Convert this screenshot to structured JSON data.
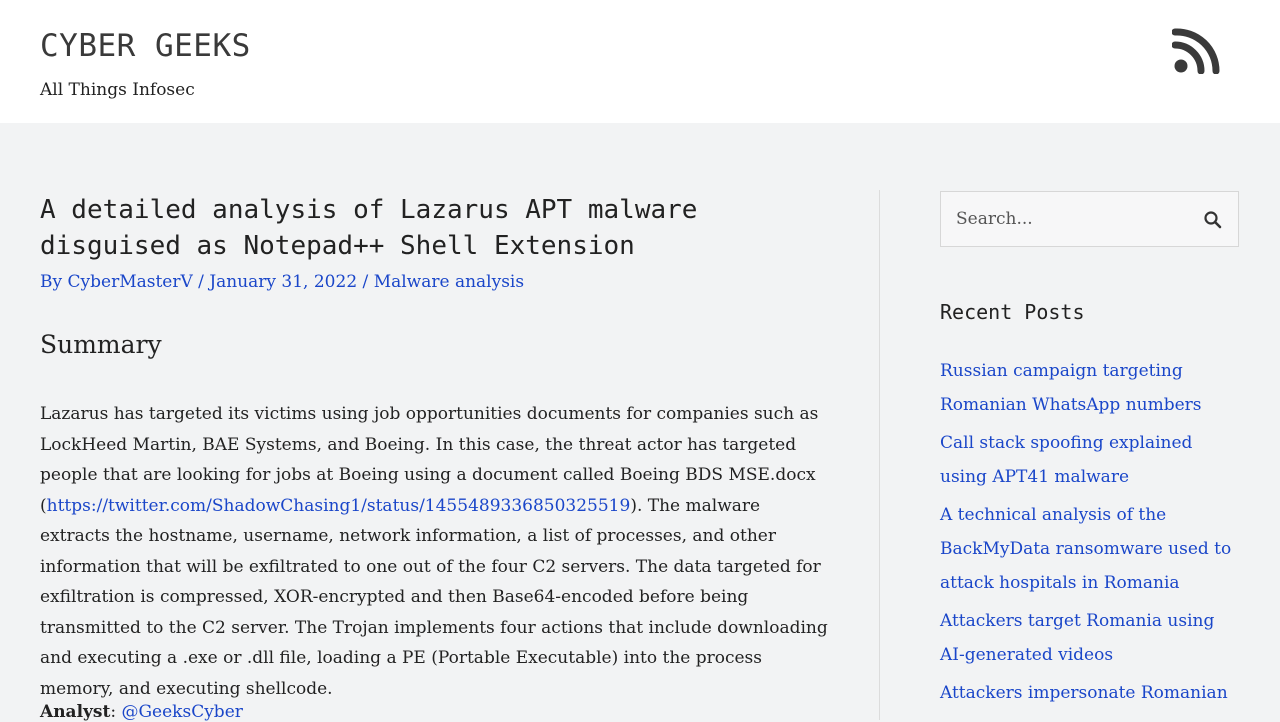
{
  "header": {
    "site_title": "CYBER GEEKS",
    "tagline": "All Things Infosec",
    "rss_icon": "rss-icon"
  },
  "post": {
    "title": "A detailed analysis of Lazarus APT malware disguised as Notepad++ Shell Extension",
    "meta": {
      "by_prefix": "By",
      "author": "CyberMasterV",
      "sep1": "/",
      "date": "January 31, 2022",
      "sep2": "/",
      "category": "Malware analysis"
    },
    "summary_heading": "Summary",
    "body_before_link": "Lazarus has targeted its victims using job opportunities documents for companies such as LockHeed Martin, BAE Systems, and Boeing. In this case, the threat actor has targeted people that are looking for jobs at Boeing using a document called Boeing BDS MSE.docx (",
    "body_link": "https://twitter.com/ShadowChasing1/status/1455489336850325519",
    "body_after_link": "). The malware extracts the hostname, username, network information, a list of processes, and other information that will be exfiltrated to one out of the four C2 servers. The data targeted for exfiltration is compressed, XOR-encrypted and then Base64-encoded before being transmitted to the C2 server. The Trojan implements four actions that include downloading and executing a .exe or .dll file, loading a PE (Portable Executable) into the process memory, and executing shellcode.",
    "analyst_label": "Analyst",
    "analyst_colon": ":",
    "analyst_handle": "@GeeksCyber"
  },
  "sidebar": {
    "search_placeholder": "Search...",
    "search_icon": "search-icon",
    "recent_heading": "Recent Posts",
    "recent_posts": [
      "Russian campaign targeting Romanian WhatsApp numbers",
      "Call stack spoofing explained using APT41 malware",
      "A technical analysis of the BackMyData ransomware used to attack hospitals in Romania",
      "Attackers target Romania using AI-generated videos",
      "Attackers impersonate Romanian"
    ]
  },
  "colors": {
    "link": "#1a46c9",
    "background": "#f2f3f4",
    "header_bg": "#ffffff",
    "text": "#222222"
  }
}
